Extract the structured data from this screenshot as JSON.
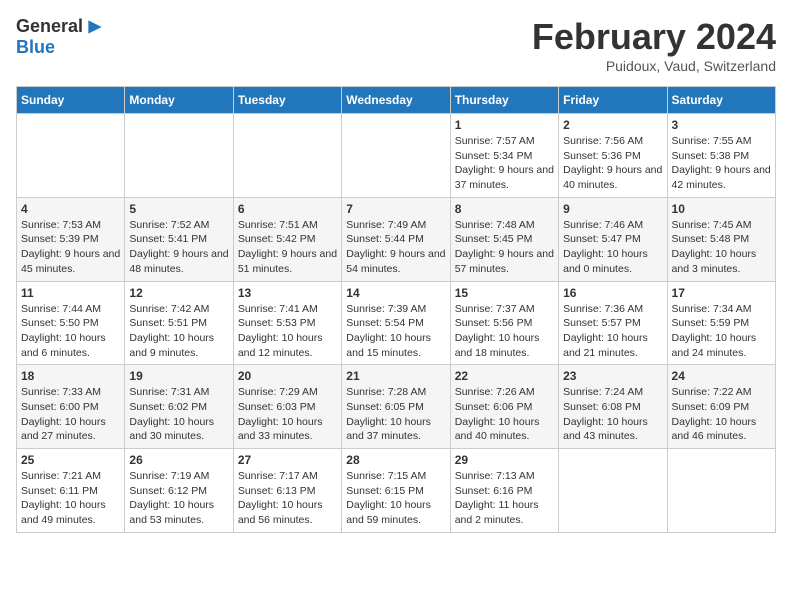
{
  "logo": {
    "general": "General",
    "blue": "Blue"
  },
  "header": {
    "month": "February 2024",
    "location": "Puidoux, Vaud, Switzerland"
  },
  "weekdays": [
    "Sunday",
    "Monday",
    "Tuesday",
    "Wednesday",
    "Thursday",
    "Friday",
    "Saturday"
  ],
  "weeks": [
    [
      {
        "day": "",
        "info": ""
      },
      {
        "day": "",
        "info": ""
      },
      {
        "day": "",
        "info": ""
      },
      {
        "day": "",
        "info": ""
      },
      {
        "day": "1",
        "info": "Sunrise: 7:57 AM\nSunset: 5:34 PM\nDaylight: 9 hours and 37 minutes."
      },
      {
        "day": "2",
        "info": "Sunrise: 7:56 AM\nSunset: 5:36 PM\nDaylight: 9 hours and 40 minutes."
      },
      {
        "day": "3",
        "info": "Sunrise: 7:55 AM\nSunset: 5:38 PM\nDaylight: 9 hours and 42 minutes."
      }
    ],
    [
      {
        "day": "4",
        "info": "Sunrise: 7:53 AM\nSunset: 5:39 PM\nDaylight: 9 hours and 45 minutes."
      },
      {
        "day": "5",
        "info": "Sunrise: 7:52 AM\nSunset: 5:41 PM\nDaylight: 9 hours and 48 minutes."
      },
      {
        "day": "6",
        "info": "Sunrise: 7:51 AM\nSunset: 5:42 PM\nDaylight: 9 hours and 51 minutes."
      },
      {
        "day": "7",
        "info": "Sunrise: 7:49 AM\nSunset: 5:44 PM\nDaylight: 9 hours and 54 minutes."
      },
      {
        "day": "8",
        "info": "Sunrise: 7:48 AM\nSunset: 5:45 PM\nDaylight: 9 hours and 57 minutes."
      },
      {
        "day": "9",
        "info": "Sunrise: 7:46 AM\nSunset: 5:47 PM\nDaylight: 10 hours and 0 minutes."
      },
      {
        "day": "10",
        "info": "Sunrise: 7:45 AM\nSunset: 5:48 PM\nDaylight: 10 hours and 3 minutes."
      }
    ],
    [
      {
        "day": "11",
        "info": "Sunrise: 7:44 AM\nSunset: 5:50 PM\nDaylight: 10 hours and 6 minutes."
      },
      {
        "day": "12",
        "info": "Sunrise: 7:42 AM\nSunset: 5:51 PM\nDaylight: 10 hours and 9 minutes."
      },
      {
        "day": "13",
        "info": "Sunrise: 7:41 AM\nSunset: 5:53 PM\nDaylight: 10 hours and 12 minutes."
      },
      {
        "day": "14",
        "info": "Sunrise: 7:39 AM\nSunset: 5:54 PM\nDaylight: 10 hours and 15 minutes."
      },
      {
        "day": "15",
        "info": "Sunrise: 7:37 AM\nSunset: 5:56 PM\nDaylight: 10 hours and 18 minutes."
      },
      {
        "day": "16",
        "info": "Sunrise: 7:36 AM\nSunset: 5:57 PM\nDaylight: 10 hours and 21 minutes."
      },
      {
        "day": "17",
        "info": "Sunrise: 7:34 AM\nSunset: 5:59 PM\nDaylight: 10 hours and 24 minutes."
      }
    ],
    [
      {
        "day": "18",
        "info": "Sunrise: 7:33 AM\nSunset: 6:00 PM\nDaylight: 10 hours and 27 minutes."
      },
      {
        "day": "19",
        "info": "Sunrise: 7:31 AM\nSunset: 6:02 PM\nDaylight: 10 hours and 30 minutes."
      },
      {
        "day": "20",
        "info": "Sunrise: 7:29 AM\nSunset: 6:03 PM\nDaylight: 10 hours and 33 minutes."
      },
      {
        "day": "21",
        "info": "Sunrise: 7:28 AM\nSunset: 6:05 PM\nDaylight: 10 hours and 37 minutes."
      },
      {
        "day": "22",
        "info": "Sunrise: 7:26 AM\nSunset: 6:06 PM\nDaylight: 10 hours and 40 minutes."
      },
      {
        "day": "23",
        "info": "Sunrise: 7:24 AM\nSunset: 6:08 PM\nDaylight: 10 hours and 43 minutes."
      },
      {
        "day": "24",
        "info": "Sunrise: 7:22 AM\nSunset: 6:09 PM\nDaylight: 10 hours and 46 minutes."
      }
    ],
    [
      {
        "day": "25",
        "info": "Sunrise: 7:21 AM\nSunset: 6:11 PM\nDaylight: 10 hours and 49 minutes."
      },
      {
        "day": "26",
        "info": "Sunrise: 7:19 AM\nSunset: 6:12 PM\nDaylight: 10 hours and 53 minutes."
      },
      {
        "day": "27",
        "info": "Sunrise: 7:17 AM\nSunset: 6:13 PM\nDaylight: 10 hours and 56 minutes."
      },
      {
        "day": "28",
        "info": "Sunrise: 7:15 AM\nSunset: 6:15 PM\nDaylight: 10 hours and 59 minutes."
      },
      {
        "day": "29",
        "info": "Sunrise: 7:13 AM\nSunset: 6:16 PM\nDaylight: 11 hours and 2 minutes."
      },
      {
        "day": "",
        "info": ""
      },
      {
        "day": "",
        "info": ""
      }
    ]
  ]
}
